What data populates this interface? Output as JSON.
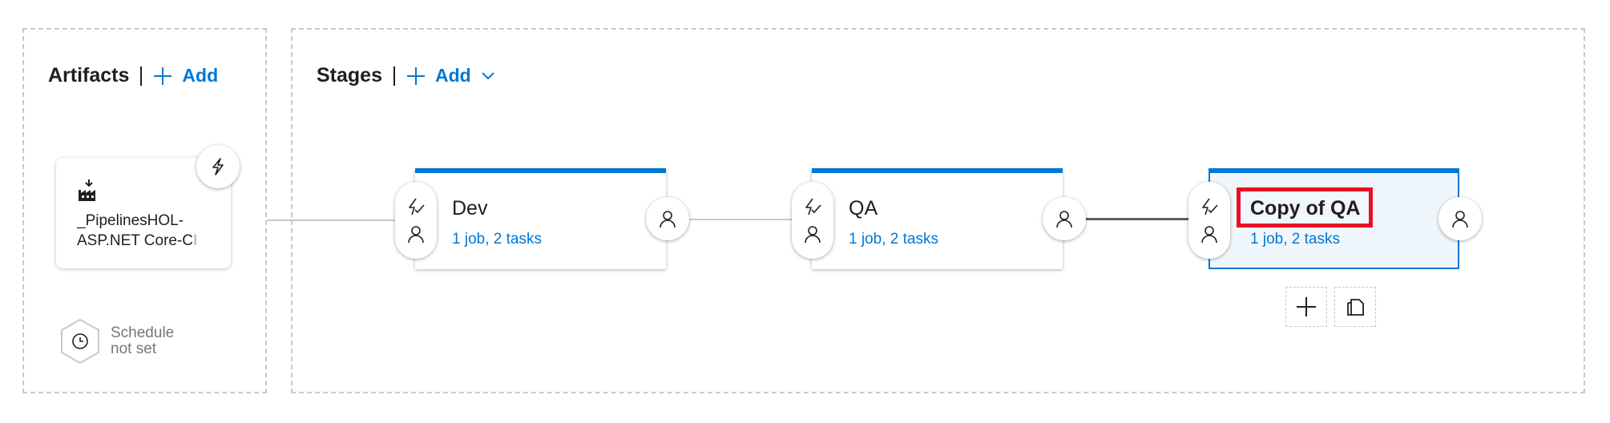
{
  "artifacts": {
    "title": "Artifacts",
    "add_label": "Add",
    "card": {
      "name_line1": "_PipelinesHOL-",
      "name_line2_main": "ASP.NET Core-C",
      "name_line2_faded": "I"
    },
    "schedule": {
      "line1": "Schedule",
      "line2": "not set"
    }
  },
  "stages": {
    "title": "Stages",
    "add_label": "Add",
    "items": [
      {
        "name": "Dev",
        "summary": "1 job, 2 tasks"
      },
      {
        "name": "QA",
        "summary": "1 job, 2 tasks"
      },
      {
        "name": "Copy of QA",
        "summary": "1 job, 2 tasks",
        "selected": true
      }
    ]
  },
  "icons": {
    "add": "plus-icon",
    "dropdown": "chevron-down-icon",
    "trigger": "lightning-icon",
    "pre_deployment_conditions": "lightning-check-icon",
    "approvers": "person-icon",
    "schedule": "clock-icon",
    "artifact": "build-factory-icon",
    "clone": "copy-icon"
  },
  "colors": {
    "accent": "#0078d4",
    "highlight": "#e81123",
    "selected_bg": "#eff6fc"
  }
}
